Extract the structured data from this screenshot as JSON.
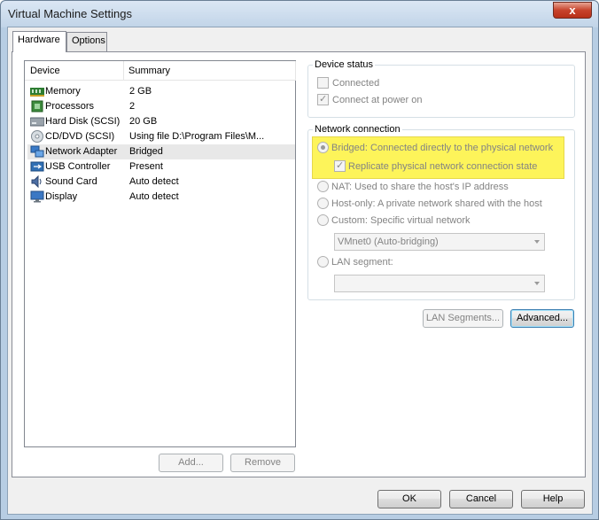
{
  "window": {
    "title": "Virtual Machine Settings",
    "close_glyph": "x"
  },
  "tabs": [
    {
      "label": "Hardware"
    },
    {
      "label": "Options"
    }
  ],
  "device_list": {
    "headers": {
      "device": "Device",
      "summary": "Summary"
    },
    "rows": [
      {
        "device": "Memory",
        "summary": "2 GB",
        "icon": "memory-icon"
      },
      {
        "device": "Processors",
        "summary": "2",
        "icon": "processor-icon"
      },
      {
        "device": "Hard Disk (SCSI)",
        "summary": "20 GB",
        "icon": "hard-disk-icon"
      },
      {
        "device": "CD/DVD (SCSI)",
        "summary": "Using file D:\\Program Files\\M...",
        "icon": "cd-dvd-icon"
      },
      {
        "device": "Network Adapter",
        "summary": "Bridged",
        "icon": "network-adapter-icon"
      },
      {
        "device": "USB Controller",
        "summary": "Present",
        "icon": "usb-icon"
      },
      {
        "device": "Sound Card",
        "summary": "Auto detect",
        "icon": "sound-card-icon"
      },
      {
        "device": "Display",
        "summary": "Auto detect",
        "icon": "display-icon"
      }
    ],
    "selected_index": 4
  },
  "list_buttons": {
    "add": "Add...",
    "remove": "Remove"
  },
  "device_status": {
    "title": "Device status",
    "connected": "Connected",
    "connect_at_power_on": "Connect at power on"
  },
  "network_connection": {
    "title": "Network connection",
    "bridged": "Bridged: Connected directly to the physical network",
    "replicate": "Replicate physical network connection state",
    "nat": "NAT: Used to share the host's IP address",
    "host_only": "Host-only: A private network shared with the host",
    "custom": "Custom: Specific virtual network",
    "custom_select": "VMnet0 (Auto-bridging)",
    "lan_segment": "LAN segment:",
    "lan_select": ""
  },
  "network_buttons": {
    "lan_segments": "LAN Segments...",
    "advanced": "Advanced..."
  },
  "footer": {
    "ok": "OK",
    "cancel": "Cancel",
    "help": "Help"
  },
  "colors": {
    "highlight": "#fdf45a",
    "window_frame": "#b7cde3"
  }
}
